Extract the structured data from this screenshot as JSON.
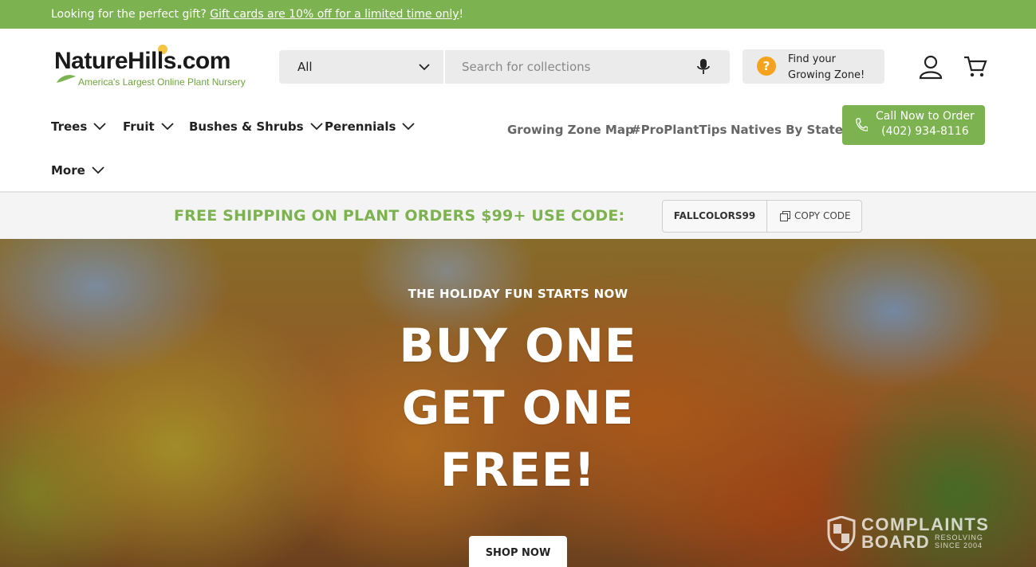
{
  "announcement": {
    "text": "Looking for the perfect gift? ",
    "link": "Gift cards are 10% off for a limited time only",
    "suffix": "!"
  },
  "logo": {
    "name": "NatureHills.com",
    "tagline": "America's Largest Online Plant Nursery"
  },
  "search": {
    "category": "All",
    "placeholder": "Search for collections"
  },
  "zone": {
    "label": "Find your\nGrowing Zone!"
  },
  "nav": {
    "items": [
      {
        "label": "Trees"
      },
      {
        "label": "Fruit"
      },
      {
        "label": "Bushes & Shrubs"
      },
      {
        "label": "Perennials"
      },
      {
        "label": "More"
      }
    ],
    "secondary": [
      {
        "label": "Growing Zone Map"
      },
      {
        "label": "#ProPlantTips"
      },
      {
        "label": "Natives By State"
      }
    ],
    "call": "Call Now to Order\n(402) 934-8116"
  },
  "promo": {
    "text": "FREE SHIPPING ON PLANT ORDERS $99+ USE CODE:",
    "code": "FALLCOLORS99",
    "copy_label": "COPY CODE"
  },
  "hero": {
    "kicker": "THE HOLIDAY FUN STARTS NOW",
    "line1": "BUY ONE",
    "line2": "GET ONE",
    "line3": "FREE!",
    "cta": "SHOP NOW"
  },
  "watermark": {
    "line1": "COMPLAINTS",
    "line2": "BOARD",
    "sub": "RESOLVING\nSINCE 2004"
  },
  "colors": {
    "brand_green": "#7cb24f",
    "zone_orange": "#f4a31c"
  }
}
